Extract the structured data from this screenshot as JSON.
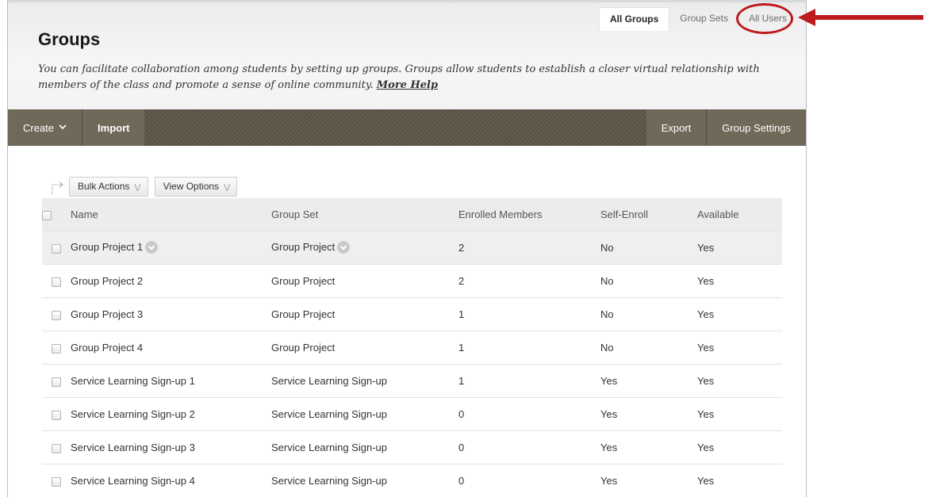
{
  "tabs": [
    {
      "label": "All Groups",
      "active": true
    },
    {
      "label": "Group Sets",
      "active": false
    },
    {
      "label": "All Users",
      "active": false
    }
  ],
  "page": {
    "title": "Groups",
    "description": "You can facilitate collaboration among students by setting up groups. Groups allow students to establish a closer virtual relationship with members of the class and promote a sense of online community.",
    "help_link": "More Help"
  },
  "actionbar": {
    "create_label": "Create",
    "import_label": "Import",
    "export_label": "Export",
    "group_settings_label": "Group Settings"
  },
  "toolbar": {
    "bulk_actions_label": "Bulk Actions",
    "view_options_label": "View Options"
  },
  "table": {
    "headers": {
      "name": "Name",
      "group_set": "Group Set",
      "enrolled": "Enrolled Members",
      "self_enroll": "Self-Enroll",
      "available": "Available"
    },
    "rows": [
      {
        "name": "Group Project 1",
        "group_set": "Group Project",
        "enrolled": "2",
        "self_enroll": "No",
        "available": "Yes"
      },
      {
        "name": "Group Project 2",
        "group_set": "Group Project",
        "enrolled": "2",
        "self_enroll": "No",
        "available": "Yes"
      },
      {
        "name": "Group Project 3",
        "group_set": "Group Project",
        "enrolled": "1",
        "self_enroll": "No",
        "available": "Yes"
      },
      {
        "name": "Group Project 4",
        "group_set": "Group Project",
        "enrolled": "1",
        "self_enroll": "No",
        "available": "Yes"
      },
      {
        "name": "Service Learning Sign-up 1",
        "group_set": "Service Learning Sign-up",
        "enrolled": "1",
        "self_enroll": "Yes",
        "available": "Yes"
      },
      {
        "name": "Service Learning Sign-up 2",
        "group_set": "Service Learning Sign-up",
        "enrolled": "0",
        "self_enroll": "Yes",
        "available": "Yes"
      },
      {
        "name": "Service Learning Sign-up 3",
        "group_set": "Service Learning Sign-up",
        "enrolled": "0",
        "self_enroll": "Yes",
        "available": "Yes"
      },
      {
        "name": "Service Learning Sign-up 4",
        "group_set": "Service Learning Sign-up",
        "enrolled": "0",
        "self_enroll": "Yes",
        "available": "Yes"
      }
    ]
  },
  "icons": {
    "create_menu": "chevron-down-icon",
    "bulk_arrow": "bulk-select-arrow-icon",
    "dropdown": "double-chevron-down-icon",
    "row_menu": "circle-chevron-down-icon"
  },
  "colors": {
    "actionbar": "#5b5547",
    "actionbar_button": "#6f6959",
    "callout": "#bd1a1e",
    "header_bg": "#f3f3f3",
    "row_highlight": "#efefef"
  }
}
